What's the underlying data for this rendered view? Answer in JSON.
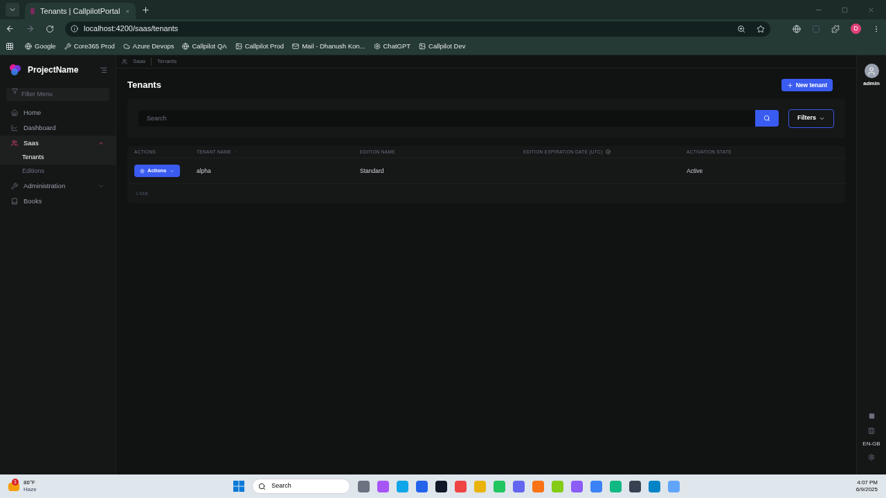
{
  "browser": {
    "tab_title": "Tenants | CallpilotPortal",
    "url": "localhost:4200/saas/tenants",
    "profile_initial": "D",
    "bookmarks": [
      {
        "label": "Google",
        "kind": "globe"
      },
      {
        "label": "Core365 Prod",
        "kind": "tool"
      },
      {
        "label": "Azure Devops",
        "kind": "azure"
      },
      {
        "label": "Callpilot QA",
        "kind": "globe"
      },
      {
        "label": "Callpilot Prod",
        "kind": "image"
      },
      {
        "label": "Mail - Dhanush Kon...",
        "kind": "mail"
      },
      {
        "label": "ChatGPT",
        "kind": "chat"
      },
      {
        "label": "Callpilot Dev",
        "kind": "image"
      }
    ]
  },
  "sidebar": {
    "brand": "ProjectName",
    "filter_placeholder": "Filter Menu",
    "items": [
      {
        "label": "Home",
        "kind": "home",
        "selected": false
      },
      {
        "label": "Dashboard",
        "kind": "chart",
        "selected": false
      },
      {
        "label": "Saas",
        "kind": "users",
        "selected": true,
        "expanded": true,
        "children": [
          {
            "label": "Tenants",
            "selected": true
          },
          {
            "label": "Editions",
            "selected": false
          }
        ]
      },
      {
        "label": "Administration",
        "kind": "wrench",
        "selected": false,
        "expanded": false
      },
      {
        "label": "Books",
        "kind": "book",
        "selected": false
      }
    ]
  },
  "breadcrumb": [
    "Saas",
    "Tenants"
  ],
  "page": {
    "title": "Tenants",
    "new_button": "New tenant",
    "search_placeholder": "Search",
    "filters_button": "Filters",
    "table": {
      "columns": [
        {
          "label": "ACTIONS",
          "kind": "plain"
        },
        {
          "label": "TENANT NAME",
          "kind": "sortable"
        },
        {
          "label": "EDITION NAME",
          "kind": "plain"
        },
        {
          "label": "EDITION EXPIRATION DATE (UTC)",
          "kind": "info"
        },
        {
          "label": "ACTIVATION STATE",
          "kind": "plain"
        }
      ],
      "rows": [
        {
          "action": "Actions",
          "tenant": "alpha",
          "edition": "Standard",
          "state": "Active"
        }
      ],
      "total": "1 total"
    }
  },
  "right_rail": {
    "user": "admin",
    "language": "EN-GB"
  },
  "taskbar": {
    "weather_badge": "1",
    "temperature": "86°F",
    "condition": "Haze",
    "search": "Search",
    "time": "4:07 PM",
    "date": "6/9/2025"
  }
}
